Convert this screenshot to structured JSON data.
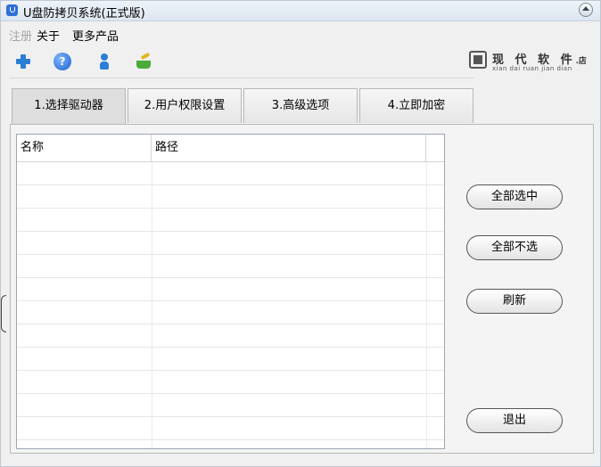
{
  "window": {
    "title": "U盘防拷贝系统(正式版)"
  },
  "menu": {
    "items": [
      "注册",
      "关于",
      "更多产品"
    ]
  },
  "toolbar": {
    "icons": [
      "plus-icon",
      "help-icon",
      "user-icon",
      "basket-icon"
    ]
  },
  "logo": {
    "text": "现 代 软 件",
    "suffix": ".店",
    "pinyin": "xian dai ruan jian dian"
  },
  "tabs": [
    "1.选择驱动器",
    "2.用户权限设置",
    "3.高级选项",
    "4.立即加密"
  ],
  "table": {
    "columns": [
      "名称",
      "路径"
    ],
    "rows": []
  },
  "buttons": {
    "select_all": "全部选中",
    "select_none": "全部不选",
    "refresh": "刷新",
    "exit": "退出"
  },
  "colors": {
    "accent": "#2b7fd4",
    "titlebar": "#dde6f0"
  }
}
